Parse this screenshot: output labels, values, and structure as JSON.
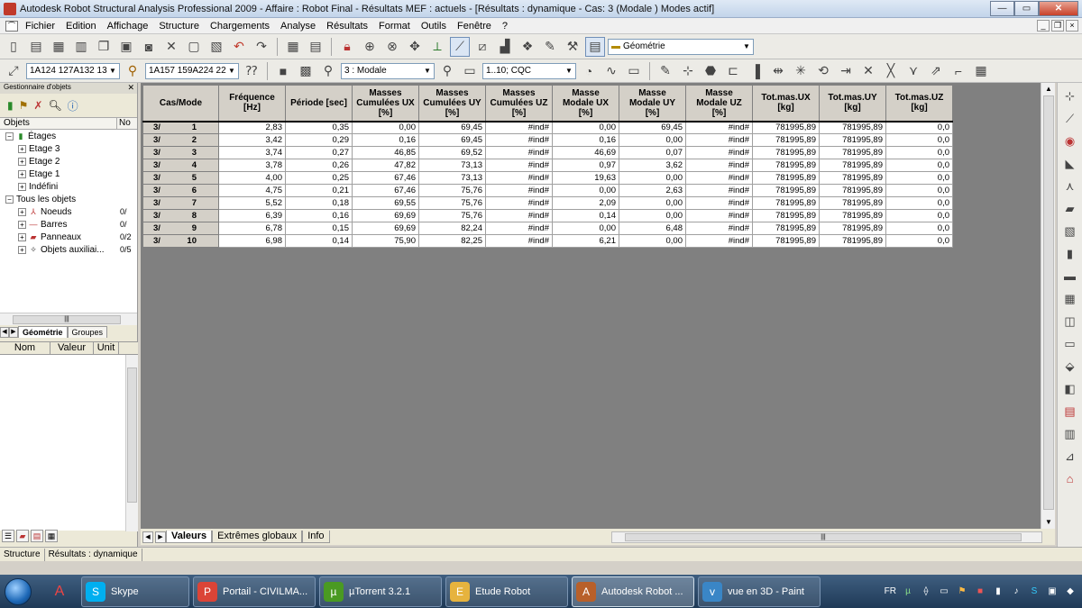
{
  "window": {
    "title": "Autodesk Robot Structural Analysis Professional 2009 - Affaire : Robot Final - Résultats MEF : actuels - [Résultats : dynamique - Cas: 3 (Modale ) Modes actif]"
  },
  "menu": [
    "Fichier",
    "Edition",
    "Affichage",
    "Structure",
    "Chargements",
    "Analyse",
    "Résultats",
    "Format",
    "Outils",
    "Fenêtre",
    "?"
  ],
  "toolbar1": {
    "layout_combo": "Géométrie"
  },
  "toolbar2": {
    "nodes_selection": "1A124 127A132 13",
    "bars_selection": "1A157 159A224 22",
    "case_combo": "3 : Modale",
    "modes_combo": "1..10; CQC"
  },
  "object_manager": {
    "title": "Gestionnaire d'objets",
    "col_objects": "Objets",
    "col_no": "No",
    "tree": [
      {
        "label": "Étages",
        "level": 0,
        "exp": "−",
        "icon": "floors-icon",
        "count": ""
      },
      {
        "label": "Etage 3",
        "level": 1,
        "exp": "+",
        "icon": "",
        "count": ""
      },
      {
        "label": "Etage 2",
        "level": 1,
        "exp": "+",
        "icon": "",
        "count": ""
      },
      {
        "label": "Etage 1",
        "level": 1,
        "exp": "+",
        "icon": "",
        "count": ""
      },
      {
        "label": "Indéfini",
        "level": 1,
        "exp": "+",
        "icon": "",
        "count": ""
      },
      {
        "label": "Tous les objets",
        "level": 0,
        "exp": "−",
        "icon": "",
        "count": ""
      },
      {
        "label": "Noeuds",
        "level": 1,
        "exp": "+",
        "icon": "nodes-icon",
        "count": "0/"
      },
      {
        "label": "Barres",
        "level": 1,
        "exp": "+",
        "icon": "bars-icon",
        "count": "0/"
      },
      {
        "label": "Panneaux",
        "level": 1,
        "exp": "+",
        "icon": "panels-icon",
        "count": "0/2"
      },
      {
        "label": "Objets auxiliai...",
        "level": 1,
        "exp": "+",
        "icon": "aux-objects-icon",
        "count": "0/5"
      }
    ],
    "tabs": [
      "Géométrie",
      "Groupes"
    ],
    "prop_cols": [
      "Nom",
      "Valeur",
      "Unit"
    ]
  },
  "results_table": {
    "headers": [
      "Cas/Mode",
      "Fréquence\n[Hz]",
      "Période [sec]",
      "Masses\nCumulées UX\n[%]",
      "Masses\nCumulées UY\n[%]",
      "Masses\nCumulées UZ\n[%]",
      "Masse\nModale UX\n[%]",
      "Masse\nModale UY\n[%]",
      "Masse\nModale UZ\n[%]",
      "Tot.mas.UX\n[kg]",
      "Tot.mas.UY\n[kg]",
      "Tot.mas.UZ\n[kg]"
    ],
    "rows": [
      {
        "cas": "3/",
        "mode": "1",
        "vals": [
          "2,83",
          "0,35",
          "0,00",
          "69,45",
          "#ind#",
          "0,00",
          "69,45",
          "#ind#",
          "781995,89",
          "781995,89",
          "0,0"
        ]
      },
      {
        "cas": "3/",
        "mode": "2",
        "vals": [
          "3,42",
          "0,29",
          "0,16",
          "69,45",
          "#ind#",
          "0,16",
          "0,00",
          "#ind#",
          "781995,89",
          "781995,89",
          "0,0"
        ]
      },
      {
        "cas": "3/",
        "mode": "3",
        "vals": [
          "3,74",
          "0,27",
          "46,85",
          "69,52",
          "#ind#",
          "46,69",
          "0,07",
          "#ind#",
          "781995,89",
          "781995,89",
          "0,0"
        ]
      },
      {
        "cas": "3/",
        "mode": "4",
        "vals": [
          "3,78",
          "0,26",
          "47,82",
          "73,13",
          "#ind#",
          "0,97",
          "3,62",
          "#ind#",
          "781995,89",
          "781995,89",
          "0,0"
        ]
      },
      {
        "cas": "3/",
        "mode": "5",
        "vals": [
          "4,00",
          "0,25",
          "67,46",
          "73,13",
          "#ind#",
          "19,63",
          "0,00",
          "#ind#",
          "781995,89",
          "781995,89",
          "0,0"
        ]
      },
      {
        "cas": "3/",
        "mode": "6",
        "vals": [
          "4,75",
          "0,21",
          "67,46",
          "75,76",
          "#ind#",
          "0,00",
          "2,63",
          "#ind#",
          "781995,89",
          "781995,89",
          "0,0"
        ]
      },
      {
        "cas": "3/",
        "mode": "7",
        "vals": [
          "5,52",
          "0,18",
          "69,55",
          "75,76",
          "#ind#",
          "2,09",
          "0,00",
          "#ind#",
          "781995,89",
          "781995,89",
          "0,0"
        ]
      },
      {
        "cas": "3/",
        "mode": "8",
        "vals": [
          "6,39",
          "0,16",
          "69,69",
          "75,76",
          "#ind#",
          "0,14",
          "0,00",
          "#ind#",
          "781995,89",
          "781995,89",
          "0,0"
        ]
      },
      {
        "cas": "3/",
        "mode": "9",
        "vals": [
          "6,78",
          "0,15",
          "69,69",
          "82,24",
          "#ind#",
          "0,00",
          "6,48",
          "#ind#",
          "781995,89",
          "781995,89",
          "0,0"
        ]
      },
      {
        "cas": "3/",
        "mode": "10",
        "vals": [
          "6,98",
          "0,14",
          "75,90",
          "82,25",
          "#ind#",
          "6,21",
          "0,00",
          "#ind#",
          "781995,89",
          "781995,89",
          "0,0"
        ]
      }
    ]
  },
  "sheet_tabs": [
    "Valeurs",
    "Extrêmes globaux",
    "Info"
  ],
  "status": [
    "Structure",
    "Résultats : dynamique"
  ],
  "taskbar": {
    "items": [
      {
        "label": "Skype",
        "icon": "skype-icon",
        "color": "#00aff0",
        "width": 120
      },
      {
        "label": "Portail - CIVILMA...",
        "icon": "chrome-icon",
        "color": "#db4437",
        "width": 136
      },
      {
        "label": "µTorrent 3.2.1",
        "icon": "utorrent-icon",
        "color": "#4a9a22",
        "width": 136
      },
      {
        "label": "Etude Robot",
        "icon": "folder-icon",
        "color": "#e6b33e",
        "width": 136
      },
      {
        "label": "Autodesk Robot ...",
        "icon": "robot-icon",
        "color": "#b8602a",
        "width": 136,
        "active": true
      },
      {
        "label": "vue en 3D - Paint",
        "icon": "paint-icon",
        "color": "#3a86c6",
        "width": 136
      }
    ],
    "lang": "FR"
  }
}
